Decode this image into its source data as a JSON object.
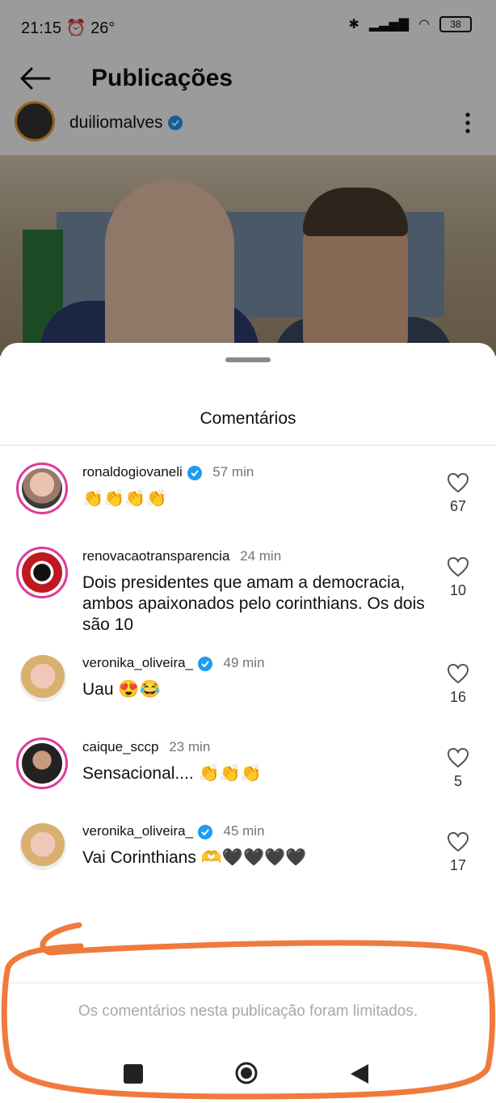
{
  "status": {
    "time": "21:15",
    "temperature": "26°",
    "battery": "38"
  },
  "header": {
    "title": "Publicações",
    "back_icon": "arrow-left-icon"
  },
  "post": {
    "author": "duiliomalves",
    "verified": true
  },
  "sheet": {
    "title": "Comentários",
    "footer_text": "Os comentários nesta publicação foram limitados."
  },
  "comments": [
    {
      "user": "ronaldogiovaneli",
      "verified": true,
      "time": "57 min",
      "text": "👏👏👏👏",
      "likes": "67"
    },
    {
      "user": "renovacaotransparencia",
      "verified": false,
      "time": "24 min",
      "text": "Dois presidentes que amam a democracia, ambos  apaixonados pelo corinthians. Os dois são 10",
      "likes": "10"
    },
    {
      "user": "veronika_oliveira_",
      "verified": true,
      "time": "49 min",
      "text": "Uau 😍😂",
      "likes": "16"
    },
    {
      "user": "caique_sccp",
      "verified": false,
      "time": "23 min",
      "text": "Sensacional.... 👏👏👏",
      "likes": "5"
    },
    {
      "user": "veronika_oliveira_",
      "verified": true,
      "time": "45 min",
      "text": "Vai Corinthians 🫶🖤🖤🖤🖤",
      "likes": "17"
    }
  ],
  "colors": {
    "verified_blue": "#1d9bf0",
    "story_ring": "#e0399a",
    "annotation_orange": "#f07a3c"
  }
}
